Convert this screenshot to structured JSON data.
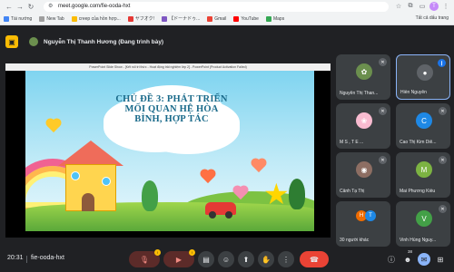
{
  "browser": {
    "url": "meet.google.com/fie-ooda-hxt",
    "avatar_letter": "T",
    "bookmarks": [
      {
        "label": "Tài nướng",
        "color": "#4285f4"
      },
      {
        "label": "New Tab",
        "color": "#9e9e9e"
      },
      {
        "label": "creep của hồn hợp...",
        "color": "#fbbc04"
      },
      {
        "label": "ヤフオク!",
        "color": "#e53935"
      },
      {
        "label": "【ドーナドゥ...",
        "color": "#7e57c2"
      },
      {
        "label": "Gmail",
        "color": "#ea4335"
      },
      {
        "label": "YouTube",
        "color": "#ff0000"
      },
      {
        "label": "Maps",
        "color": "#34a853"
      }
    ],
    "bookmarks_right": "Tất cả dấu trang"
  },
  "presenter": {
    "label": "Nguyễn Thị Thanh Hương (Đang trình bày)"
  },
  "slide": {
    "window_title": "PowerPoint Slide Show - [Kết nối tri thức - Hoạt động trải nghiệm lớp 2] - PowerPoint (Product Activation Failed)",
    "title_lines": [
      "CHỦ ĐỀ 3: PHÁT TRIỂN",
      "MỐI QUAN HỆ HÒA",
      "BÌNH, HỢP TÁC"
    ]
  },
  "participants": [
    {
      "name": "Nguyễn Thị Than...",
      "initial": "",
      "color": "#6b8f4e",
      "muted": true,
      "active": false
    },
    {
      "name": "Hiền Nguyễn",
      "initial": "",
      "color": "#3c4043",
      "muted": false,
      "active": true
    },
    {
      "name": "M S , T E ...",
      "initial": "",
      "color": "#f8bbd0",
      "muted": true,
      "active": false
    },
    {
      "name": "Cao Thị Kim Diễ...",
      "initial": "C",
      "color": "#1e88e5",
      "muted": true,
      "active": false
    },
    {
      "name": "Cảnh Tạ Thị",
      "initial": "",
      "color": "#8d6e63",
      "muted": true,
      "active": false
    },
    {
      "name": "Mai Phương Kiều",
      "initial": "M",
      "color": "#7cb342",
      "muted": true,
      "active": false
    },
    {
      "name": "30 người khác",
      "initial": "",
      "color": "#3c4043",
      "muted": false,
      "active": false
    },
    {
      "name": "Vinh Hùng Nguy...",
      "initial": "V",
      "color": "#43a047",
      "muted": true,
      "active": false
    }
  ],
  "others_group": {
    "a": "H",
    "a_color": "#ef6c00",
    "b": "T",
    "b_color": "#1e88e5"
  },
  "bottom": {
    "time": "20:31",
    "code": "fie-ooda-hxt",
    "people_count": "38"
  },
  "icons": {
    "mic": "mic-icon",
    "camera": "camera-icon",
    "captions": "captions-icon",
    "emoji": "emoji-icon",
    "present": "present-icon",
    "hand": "raise-hand-icon",
    "more": "more-icon",
    "end": "end-call-icon",
    "info": "info-icon",
    "people": "people-icon",
    "chat": "chat-icon",
    "activities": "activities-icon"
  }
}
